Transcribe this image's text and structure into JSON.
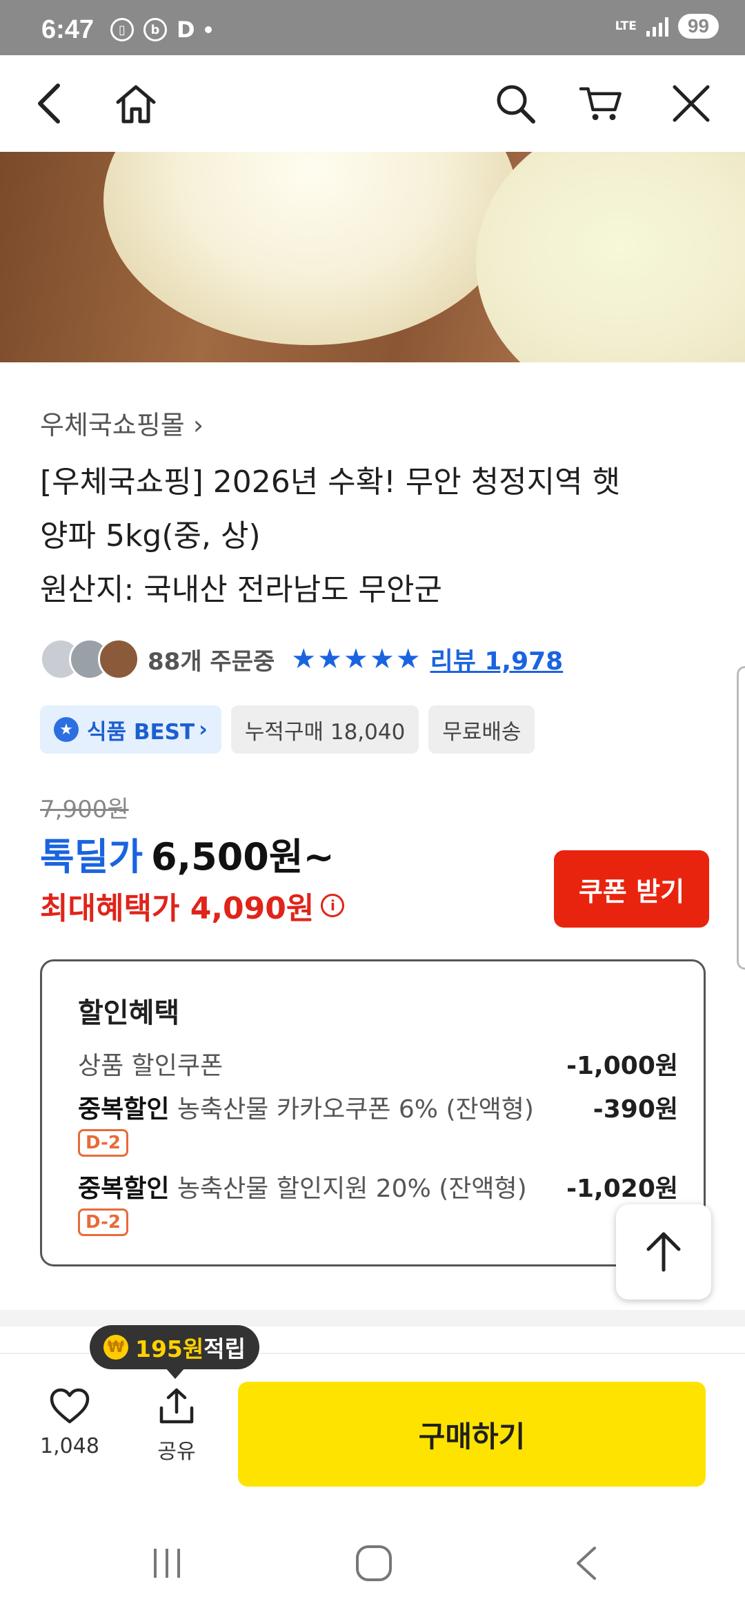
{
  "status_bar": {
    "time": "6:47",
    "icons": [
      "sim-icon",
      "b-app-icon",
      "d-app-icon",
      "dot-icon"
    ],
    "network": "LTE",
    "battery": "99"
  },
  "nav": {
    "icons": [
      "back-icon",
      "home-icon",
      "search-icon",
      "cart-icon",
      "close-icon"
    ]
  },
  "product": {
    "shop_name": "우체국쇼핑몰",
    "title_line1": "[우체국쇼핑] 2026년 수확! 무안 청정지역 햇",
    "title_line2": "양파 5kg(중, 상)",
    "title_line3": "원산지: 국내산 전라남도 무안군",
    "order_count": "88개 주문중",
    "rating_stars": 5,
    "review_label": "리뷰 1,978",
    "badges": {
      "best": "식품 BEST",
      "cumulative": "누적구매 18,040",
      "shipping": "무료배송"
    },
    "original_price": "7,900원",
    "deal_label": "톡딜가",
    "deal_price": "6,500원~",
    "max_benefit": "최대혜택가 4,090원",
    "coupon_button": "쿠폰 받기"
  },
  "discount": {
    "heading": "할인혜택",
    "rows": [
      {
        "prefix": "",
        "name": "상품 할인쿠폰",
        "value": "-1,000원",
        "tag": ""
      },
      {
        "prefix": "중복할인",
        "name": " 농축산물 카카오쿠폰 6% (잔액형)",
        "value": "-390원",
        "tag": "D-2"
      },
      {
        "prefix": "중복할인",
        "name": " 농축산물 할인지원 20% (잔액형)",
        "value": "-1,020원",
        "tag": "D-2"
      }
    ]
  },
  "bottom": {
    "points_amount": "195원",
    "points_label": " 적립",
    "like_count": "1,048",
    "share_label": "공유",
    "buy_button": "구매하기"
  },
  "colors": {
    "accent_blue": "#1a64e0",
    "accent_red": "#e0241a",
    "buy_yellow": "#ffe300",
    "coupon_red": "#e8240f"
  }
}
